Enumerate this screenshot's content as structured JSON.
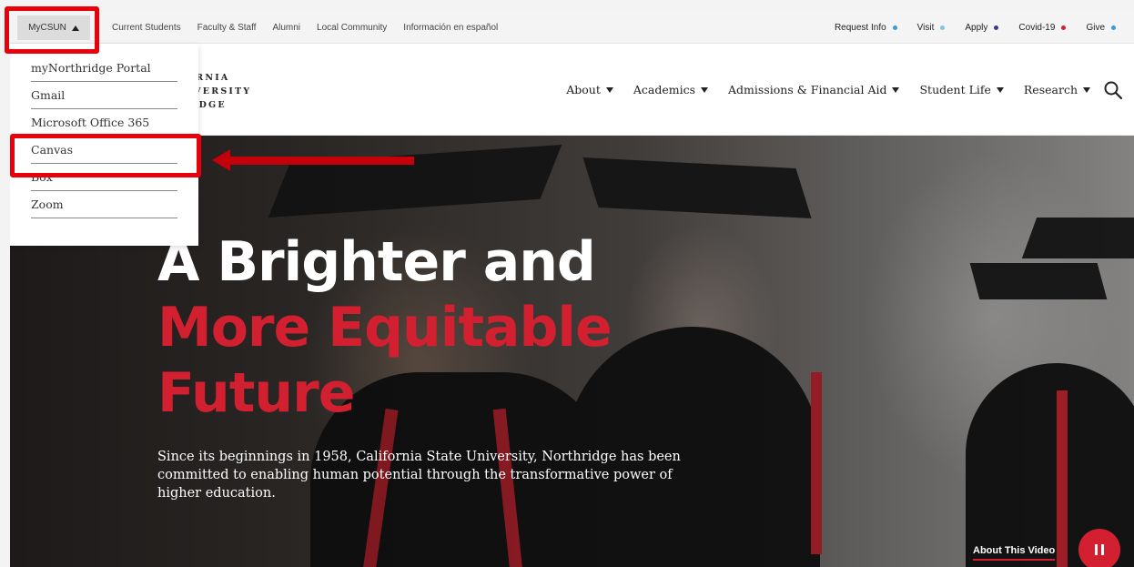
{
  "utility_bar": {
    "mycsun_label": "MyCSUN",
    "links": [
      "Current Students",
      "Faculty & Staff",
      "Alumni",
      "Local Community",
      "Información en español"
    ],
    "right_links": [
      {
        "label": "Request Info",
        "dot_color": "#3a9ad9"
      },
      {
        "label": "Visit",
        "dot_color": "#7fc4e8"
      },
      {
        "label": "Apply",
        "dot_color": "#3a3a8a"
      },
      {
        "label": "Covid-19",
        "dot_color": "#d22030"
      },
      {
        "label": "Give",
        "dot_color": "#3a9ad9"
      }
    ]
  },
  "logo": {
    "line1": "CALIFORNIA",
    "line2": "TE UNIVERSITY",
    "line3": "ORTHRIDGE"
  },
  "main_nav": [
    "About",
    "Academics",
    "Admissions & Financial Aid",
    "Student Life",
    "Research"
  ],
  "search_icon": "magnifier-icon",
  "dropdown": {
    "items": [
      "myNorthridge Portal",
      "Gmail",
      "Microsoft Office 365",
      "Canvas",
      "Box",
      "Zoom"
    ]
  },
  "hero": {
    "headline_line1": "A Brighter and",
    "headline_line2": "More Equitable",
    "headline_line3": "Future",
    "subtext": "Since its beginnings in 1958, California State University, Northridge has been committed to enabling human potential through the transformative power of higher education.",
    "about_video": "About This Video",
    "pause_icon": "pause-icon"
  },
  "colors": {
    "brand_red": "#d22030",
    "annotation_red": "#e8000b"
  }
}
